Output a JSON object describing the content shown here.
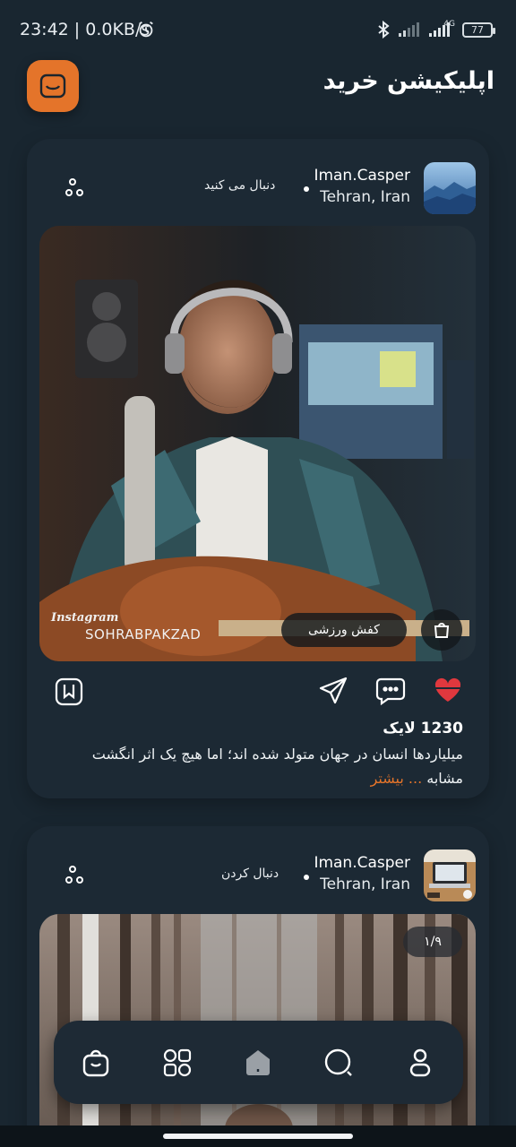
{
  "status_bar": {
    "time": "23:42 | 0.0KB/s",
    "network": "4G",
    "battery": "77"
  },
  "header": {
    "title": "اپلیکیشن خرید"
  },
  "posts": [
    {
      "username": "Iman.Casper",
      "location": "Tehran, Iran",
      "follow_label": "دنبال می کنید",
      "watermark_brand": "Instagram",
      "watermark_user": "SOHRABPAKZAD",
      "product_tag": "کفش ورزشی",
      "likes": "1230 لایک",
      "caption": "میلیاردها انسان در جهان متولد شده اند؛ اما هیچ یک اثر انگشت مشابه",
      "more_link": "... بیشتر"
    },
    {
      "username": "Iman.Casper",
      "location": "Tehran, Iran",
      "follow_label": "دنبال کردن",
      "media_counter": "۱/۹"
    }
  ],
  "icons": {
    "alarm": "alarm-clock-icon",
    "bluetooth": "bluetooth-icon",
    "signal": "signal-icon",
    "logo": "shopping-bag-icon",
    "more": "more-options-icon",
    "like": "heart-icon",
    "comment": "comment-icon",
    "share": "send-icon",
    "save": "bookmark-icon"
  },
  "nav": {
    "items": [
      "shop",
      "categories",
      "home",
      "search",
      "profile"
    ],
    "active": "home"
  },
  "colors": {
    "background": "#192630",
    "card": "#1c2934",
    "accent": "#e4742a",
    "like": "#e0383e"
  }
}
